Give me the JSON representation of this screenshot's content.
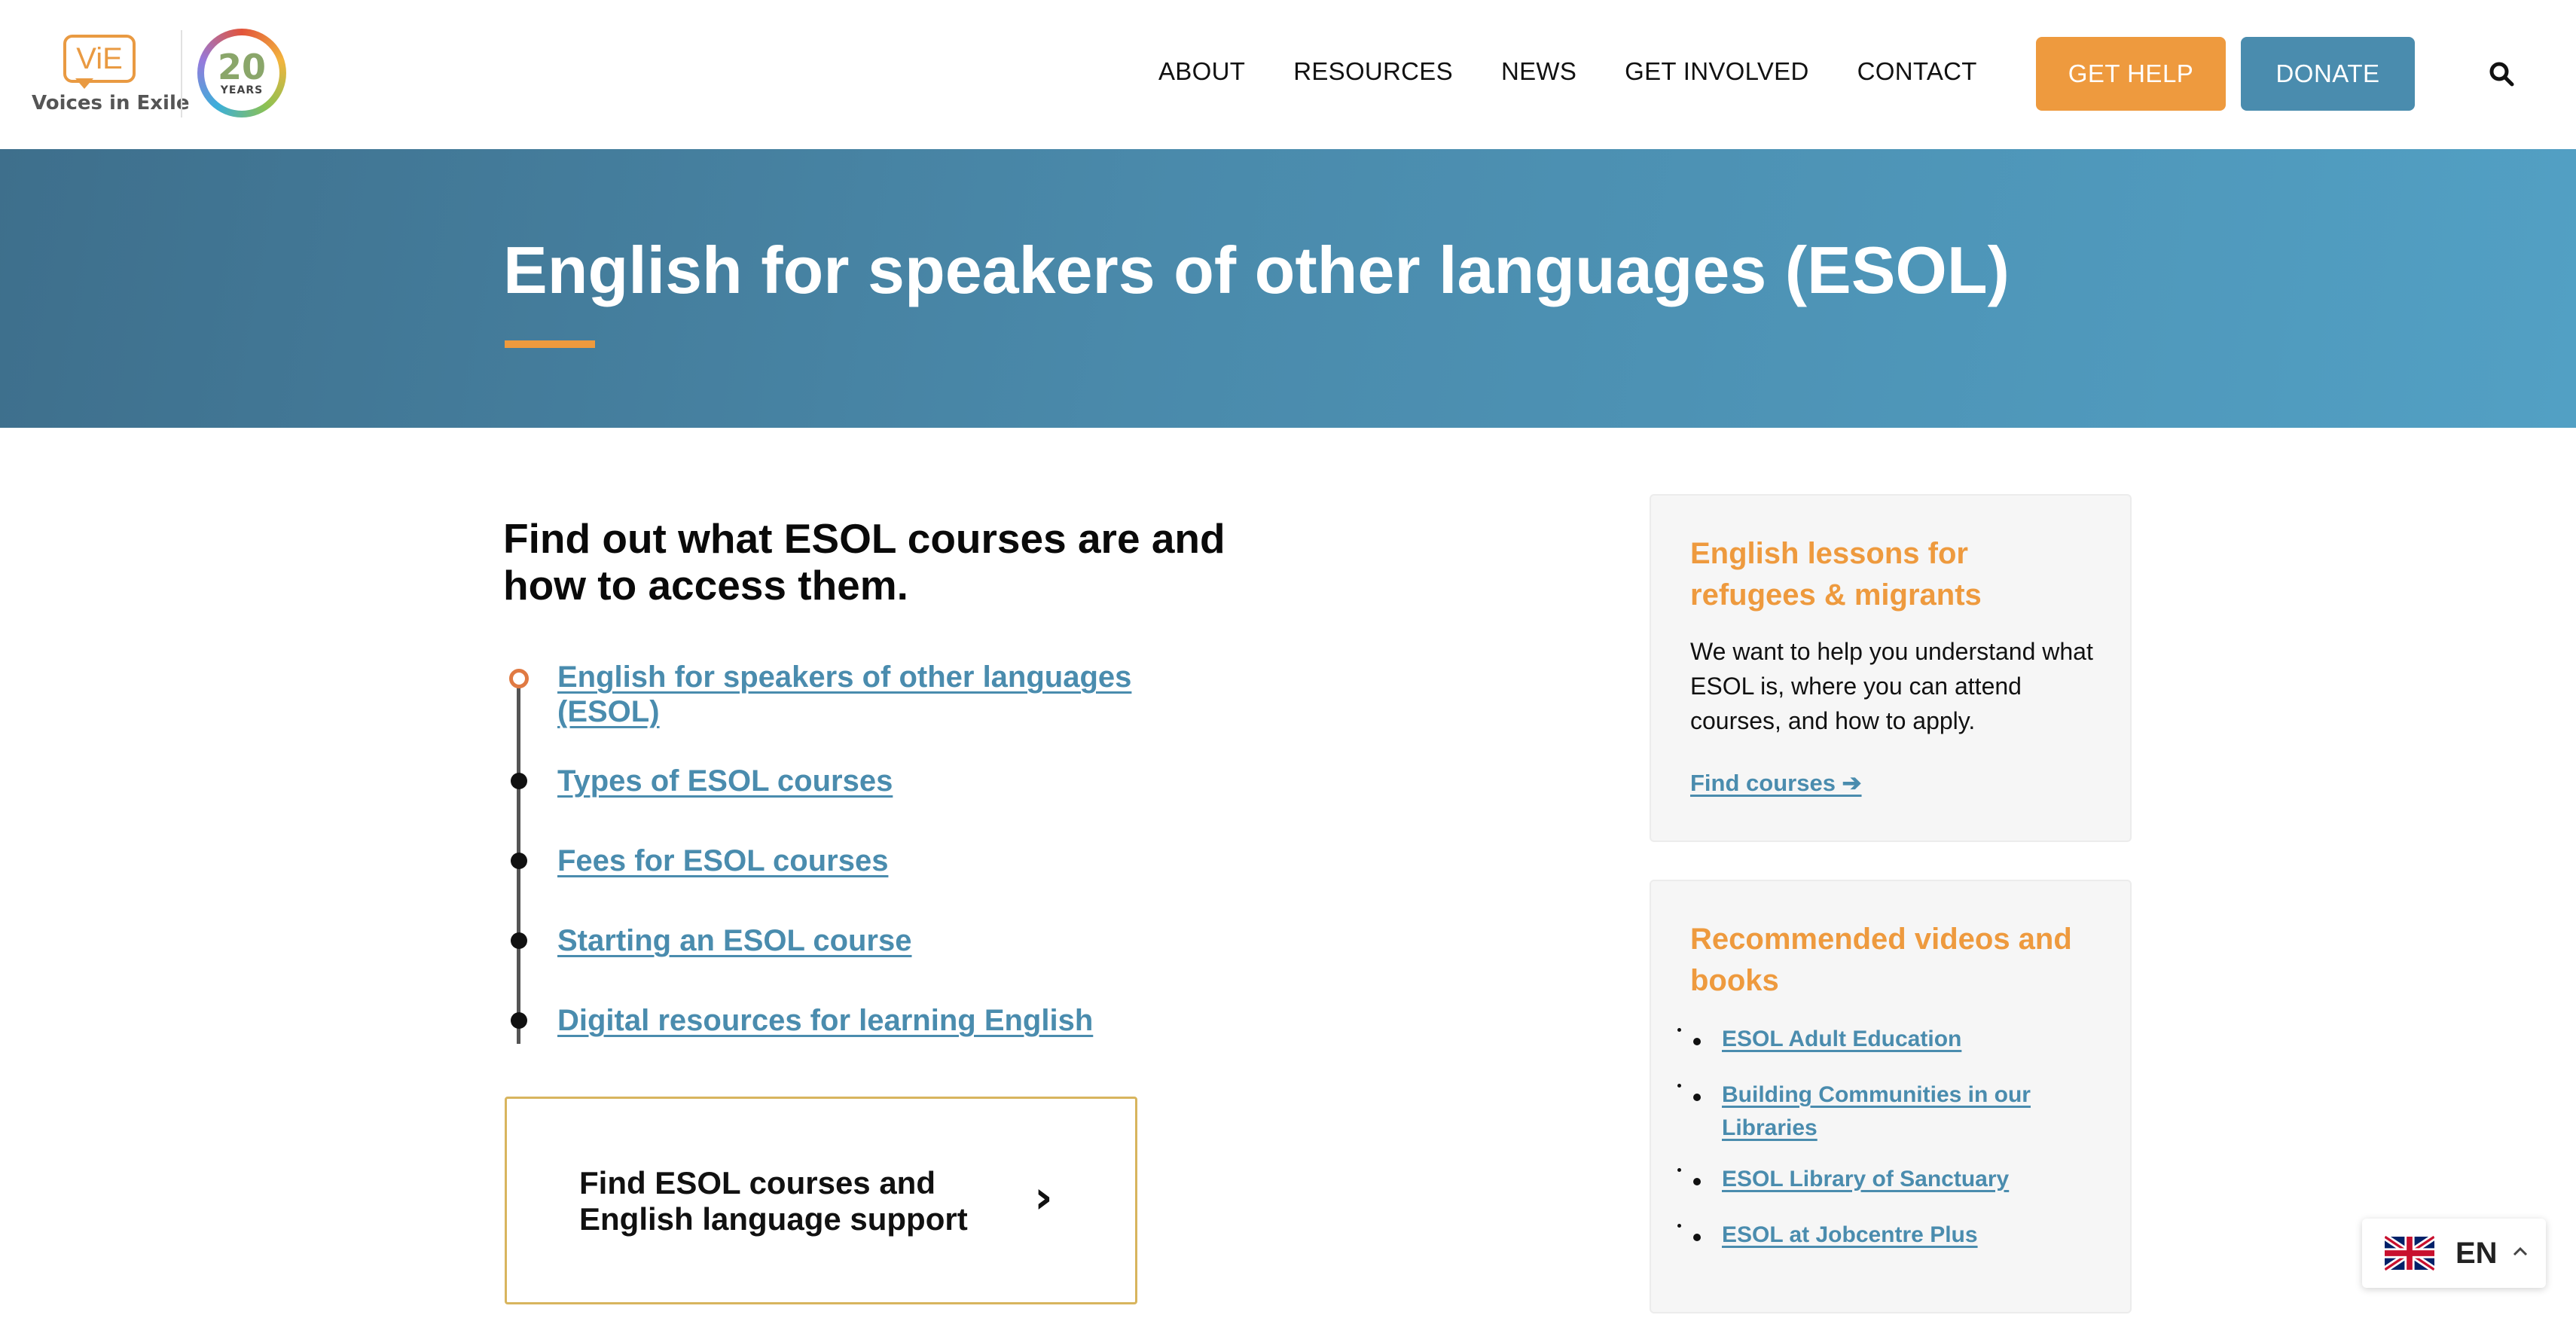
{
  "brand": {
    "logo_mark": "ViE",
    "name": "Voices in Exile",
    "anniversary_number": "20",
    "anniversary_label": "YEARS"
  },
  "nav": {
    "items": [
      {
        "label": "ABOUT"
      },
      {
        "label": "RESOURCES"
      },
      {
        "label": "NEWS"
      },
      {
        "label": "GET INVOLVED"
      },
      {
        "label": "CONTACT"
      }
    ],
    "get_help": "GET HELP",
    "donate": "DONATE",
    "search_icon": "search-icon"
  },
  "hero": {
    "title": "English for speakers of other languages (ESOL)"
  },
  "intro": {
    "heading": "Find out what ESOL courses are and how to access them."
  },
  "toc": {
    "items": [
      {
        "label": "English for speakers of other languages (ESOL)",
        "active": true
      },
      {
        "label": "Types of ESOL courses",
        "active": false
      },
      {
        "label": "Fees for ESOL courses",
        "active": false
      },
      {
        "label": "Starting an ESOL course",
        "active": false
      },
      {
        "label": "Digital resources for learning English",
        "active": false
      }
    ]
  },
  "cta": {
    "label": "Find ESOL courses and English language support",
    "arrow": "›"
  },
  "sidebar": {
    "lessons_card": {
      "title": "English lessons for refugees & migrants",
      "body": "We want to help you understand what ESOL is, where you can attend courses, and how to apply.",
      "link": "Find courses ➔"
    },
    "recommended_card": {
      "title": "Recommended videos and books",
      "items": [
        {
          "label": "ESOL Adult Education"
        },
        {
          "label": "Building Communities in our Libraries"
        },
        {
          "label": "ESOL Library of Sanctuary"
        },
        {
          "label": "ESOL at Jobcentre Plus"
        }
      ]
    }
  },
  "language": {
    "code": "EN",
    "flag_icon": "uk-flag-icon"
  },
  "colors": {
    "accent_orange": "#ee9a3e",
    "accent_blue": "#4a8cae",
    "link_blue": "#4a8cae"
  }
}
